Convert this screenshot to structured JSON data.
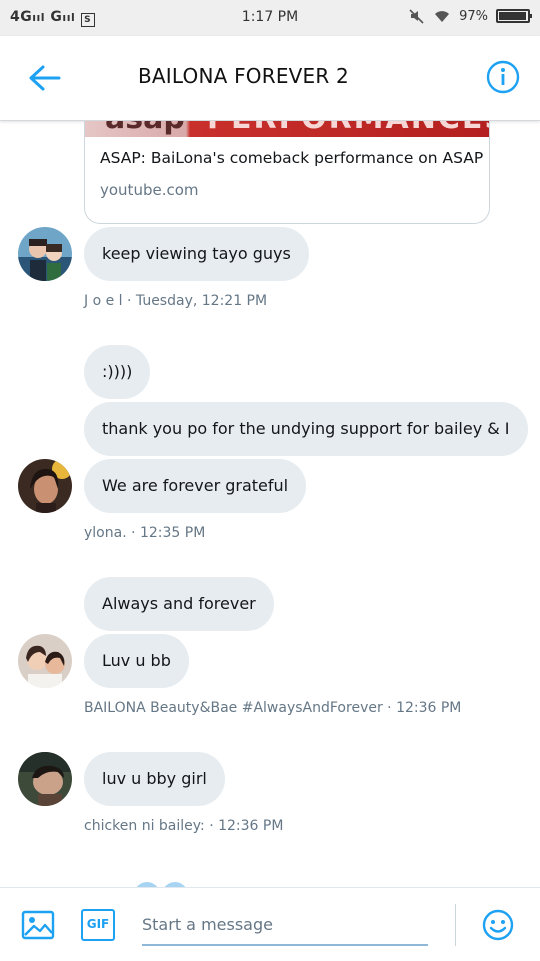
{
  "status_bar": {
    "carrier": "4Gᴵᴵᴵ Gᴵᴵᴵ",
    "time": "1:17 PM",
    "battery": "97%"
  },
  "header": {
    "title": "BAILONA FOREVER 2"
  },
  "link_card": {
    "thumb_text_1": "asap",
    "thumb_text_2": "PERFORMANCES",
    "title": "ASAP: BaiLona's comeback performance on ASAP",
    "domain": "youtube.com"
  },
  "messages": [
    {
      "text": "keep viewing tayo guys"
    },
    {
      "text": ":))))"
    },
    {
      "text": "thank you po for the undying support for bailey & I"
    },
    {
      "text": "We are forever grateful"
    },
    {
      "text": "Always and forever"
    },
    {
      "text": "Luv u bb"
    },
    {
      "text": "luv u bby girl"
    }
  ],
  "meta": {
    "joel": "J o e l · Tuesday, 12:21 PM",
    "ylona": "ylona. · 12:35 PM",
    "bailona": "BAILONA Beauty&Bae #AlwaysAndForever · 12:36 PM",
    "chicken": "chicken ni bailey: · 12:36 PM"
  },
  "composer": {
    "placeholder": "Start a message",
    "gif_label": "GIF"
  },
  "colors": {
    "accent": "#1da1f2",
    "bubble": "#e6ecf0",
    "meta": "#657786"
  },
  "icons": [
    "back-arrow-icon",
    "info-icon",
    "image-icon",
    "gif-icon",
    "emoji-icon",
    "wifi-icon",
    "mute-icon"
  ]
}
